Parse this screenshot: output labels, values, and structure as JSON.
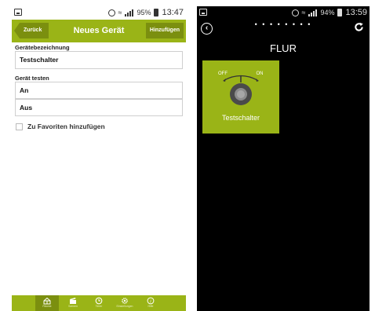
{
  "left": {
    "status": {
      "battery": "95%",
      "time": "13:47"
    },
    "header": {
      "back": "Zurück",
      "title": "Neues Gerät",
      "add": "Hinzufügen"
    },
    "name_section": {
      "label": "Gerätebezeichnung",
      "value": "Testschalter"
    },
    "test_section": {
      "label": "Gerät testen",
      "options": [
        "An",
        "Aus"
      ]
    },
    "favorite": {
      "label": "Zu Favoriten hinzufügen",
      "checked": false
    },
    "nav": [
      {
        "label": "Räume",
        "icon": "rooms-icon",
        "active": true
      },
      {
        "label": "Szenen",
        "icon": "scenes-icon",
        "active": false
      },
      {
        "label": "Timer",
        "icon": "clock-icon",
        "active": false
      },
      {
        "label": "Einstellungen",
        "icon": "settings-icon",
        "active": false
      },
      {
        "label": "Hilfe",
        "icon": "info-icon",
        "active": false
      }
    ]
  },
  "right": {
    "status": {
      "battery": "94%",
      "time": "13:59"
    },
    "page_dots": "• • • • • • • •",
    "room": "FLUR",
    "tile": {
      "label": "Testschalter",
      "off": "OFF",
      "on": "ON"
    }
  },
  "colors": {
    "accent": "#9ab417",
    "accent_dark": "#7b8f0f",
    "dark_bg": "#000000"
  }
}
